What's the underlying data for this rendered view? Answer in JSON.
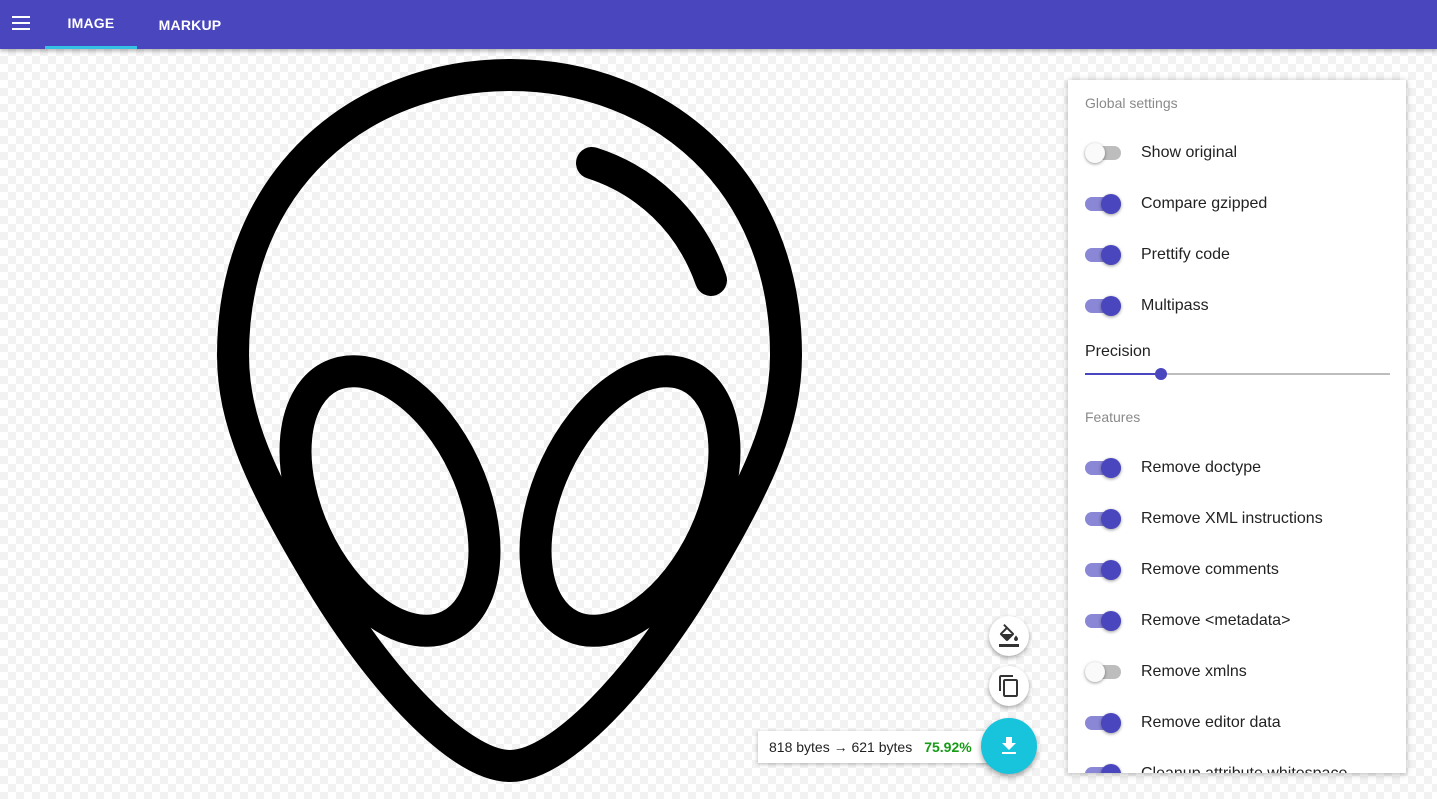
{
  "appbar": {
    "tabs": [
      {
        "label": "IMAGE",
        "active": true
      },
      {
        "label": "MARKUP",
        "active": false
      }
    ]
  },
  "settings": {
    "global_title": "Global settings",
    "global": [
      {
        "label": "Show original",
        "on": false
      },
      {
        "label": "Compare gzipped",
        "on": true
      },
      {
        "label": "Prettify code",
        "on": true
      },
      {
        "label": "Multipass",
        "on": true
      }
    ],
    "precision_label": "Precision",
    "precision_fraction": 0.25,
    "features_title": "Features",
    "features": [
      {
        "label": "Remove doctype",
        "on": true
      },
      {
        "label": "Remove XML instructions",
        "on": true
      },
      {
        "label": "Remove comments",
        "on": true
      },
      {
        "label": "Remove <metadata>",
        "on": true
      },
      {
        "label": "Remove xmlns",
        "on": false
      },
      {
        "label": "Remove editor data",
        "on": true
      },
      {
        "label": "Cleanup attribute whitespace",
        "on": true
      }
    ]
  },
  "result": {
    "sizes": "818 bytes → 621 bytes",
    "percent": "75.92%"
  },
  "icons": {
    "menu": "menu-icon",
    "background": "format-color-fill-icon",
    "copy": "content-copy-icon",
    "download": "download-icon"
  },
  "colors": {
    "primary": "#4a46be",
    "accent": "#18c3dc",
    "tab_indicator": "#35c1e4",
    "saving": "#169b16"
  }
}
